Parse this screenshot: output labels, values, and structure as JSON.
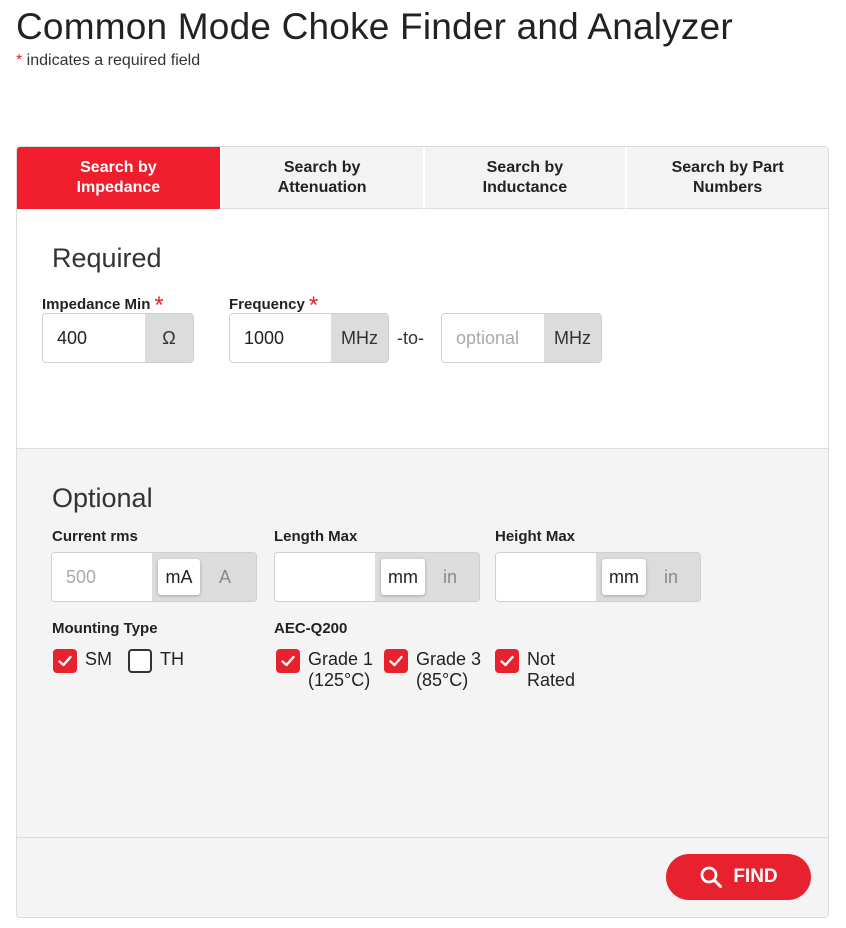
{
  "page": {
    "title": "Common Mode Choke Finder and Analyzer",
    "required_star": "*",
    "required_note": " indicates a required field"
  },
  "tabs": [
    {
      "label_line1": "Search by",
      "label_line2": "Impedance",
      "active": true
    },
    {
      "label_line1": "Search by",
      "label_line2": "Attenuation",
      "active": false
    },
    {
      "label_line1": "Search by",
      "label_line2": "Inductance",
      "active": false
    },
    {
      "label_line1": "Search by Part",
      "label_line2": "Numbers",
      "active": false
    }
  ],
  "required": {
    "heading": "Required",
    "impedance": {
      "label": "Impedance Min",
      "star": "*",
      "value": "400",
      "unit": "Ω"
    },
    "frequency": {
      "label": "Frequency",
      "star": "*",
      "value": "1000",
      "unit": "MHz",
      "to_text": "-to-",
      "max_placeholder": "optional",
      "max_unit": "MHz"
    }
  },
  "optional": {
    "heading": "Optional",
    "current": {
      "label": "Current rms",
      "value": "",
      "default_value": "500",
      "units": [
        "mA",
        "A"
      ],
      "selected_unit": "mA"
    },
    "length": {
      "label": "Length Max",
      "value": "",
      "units": [
        "mm",
        "in"
      ],
      "selected_unit": "mm"
    },
    "height": {
      "label": "Height Max",
      "value": "",
      "units": [
        "mm",
        "in"
      ],
      "selected_unit": "mm"
    },
    "mounting": {
      "label": "Mounting Type",
      "options": [
        {
          "label": "SM",
          "checked": true
        },
        {
          "label": "TH",
          "checked": false
        }
      ]
    },
    "aec": {
      "label": "AEC-Q200",
      "options": [
        {
          "line1": "Grade 1",
          "line2": "(125°C)",
          "checked": true
        },
        {
          "line1": "Grade 3",
          "line2": "(85°C)",
          "checked": true
        },
        {
          "line1": "Not",
          "line2": "Rated",
          "checked": true
        }
      ]
    }
  },
  "footer": {
    "find_label": "FIND"
  },
  "colors": {
    "accent": "#e8212e",
    "tab_active": "#f01e2c",
    "tab_inactive": "#f3f3f3",
    "section_bg": "#f4f4f4"
  }
}
